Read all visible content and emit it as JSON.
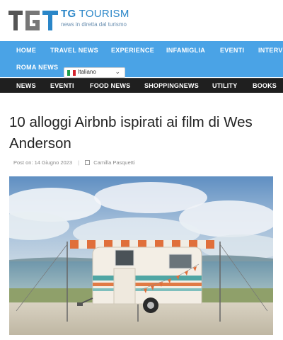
{
  "site": {
    "logo_letters": "TGT",
    "title_bold": "TG",
    "title_rest": "TOURISM",
    "tagline": "news in diretta dal turismo"
  },
  "nav_main": {
    "items": [
      "HOME",
      "TRAVEL NEWS",
      "EXPERIENCE",
      "INFAMIGLIA",
      "EVENTI",
      "INTERV",
      "ROMA NEWS"
    ]
  },
  "language": {
    "selected": "Italiano"
  },
  "nav_secondary": {
    "items": [
      "NEWS",
      "EVENTI",
      "FOOD NEWS",
      "SHOPPINGNEWS",
      "UTILITY",
      "BOOKS"
    ]
  },
  "article": {
    "title": "10 alloggi Airbnb ispirati ai film di Wes Anderson",
    "posted_prefix": "Post on:",
    "date": "14 Giugno 2023",
    "author": "Camilla Pasquetti"
  },
  "colors": {
    "nav_blue": "#4aa3e6",
    "nav_dark": "#1f1f1f",
    "brand": "#2a86c8"
  }
}
